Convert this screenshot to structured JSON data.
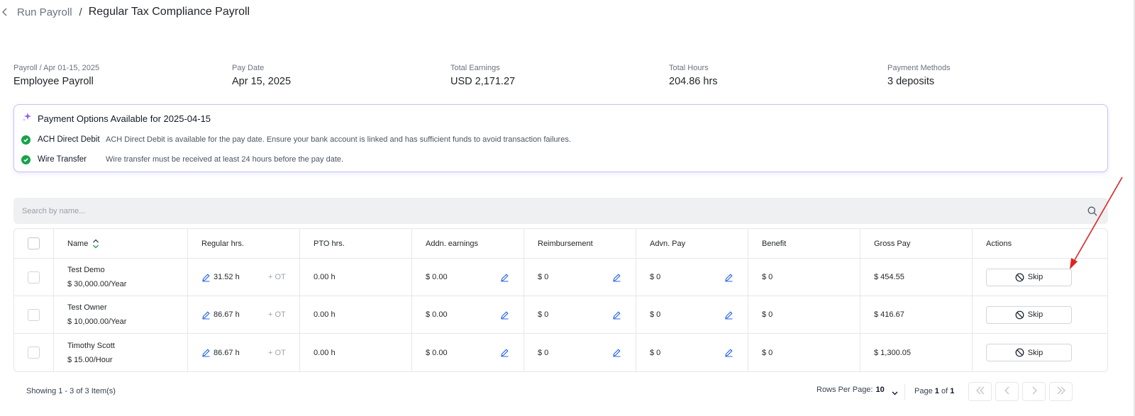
{
  "breadcrumb": {
    "parent": "Run Payroll",
    "separator": "/",
    "current": "Regular Tax Compliance Payroll"
  },
  "summary": [
    {
      "label": "Payroll / Apr 01-15, 2025",
      "value": "Employee Payroll"
    },
    {
      "label": "Pay Date",
      "value": "Apr 15, 2025"
    },
    {
      "label": "Total Earnings",
      "value": "USD 2,171.27"
    },
    {
      "label": "Total Hours",
      "value": "204.86 hrs"
    },
    {
      "label": "Payment Methods",
      "value": "3 deposits"
    }
  ],
  "payment_options": {
    "title": "Payment Options Available for 2025-04-15",
    "items": [
      {
        "name": "ACH Direct Debit",
        "description": "ACH Direct Debit is available for the pay date. Ensure your bank account is linked and has sufficient funds to avoid transaction failures."
      },
      {
        "name": "Wire Transfer",
        "description": "Wire transfer must be received at least 24 hours before the pay date."
      }
    ]
  },
  "search": {
    "placeholder": "Search by name..."
  },
  "table": {
    "columns": [
      "Name",
      "Regular hrs.",
      "PTO hrs.",
      "Addn. earnings",
      "Reimbursement",
      "Advn. Pay",
      "Benefit",
      "Gross Pay",
      "Actions"
    ],
    "ot_label": "+ OT",
    "skip_label": "Skip",
    "rows": [
      {
        "name": "Test Demo",
        "rate": "$ 30,000.00/Year",
        "regular": "31.52 h",
        "pto": "0.00 h",
        "addn": "$ 0.00",
        "reimb": "$ 0",
        "advn": "$ 0",
        "benefit": "$ 0",
        "gross": "$ 454.55"
      },
      {
        "name": "Test Owner",
        "rate": "$ 10,000.00/Year",
        "regular": "86.67 h",
        "pto": "0.00 h",
        "addn": "$ 0.00",
        "reimb": "$ 0",
        "advn": "$ 0",
        "benefit": "$ 0",
        "gross": "$ 416.67"
      },
      {
        "name": "Timothy Scott",
        "rate": "$ 15.00/Hour",
        "regular": "86.67 h",
        "pto": "0.00 h",
        "addn": "$ 0.00",
        "reimb": "$ 0",
        "advn": "$ 0",
        "benefit": "$ 0",
        "gross": "$ 1,300.05"
      }
    ]
  },
  "footer": {
    "showing": "Showing 1 - 3 of 3 Item(s)",
    "rows_per_page_label": "Rows Per Page:",
    "rows_per_page_value": "10",
    "page_prefix": "Page",
    "page_current": "1",
    "page_of": "of",
    "page_total": "1"
  },
  "icons": {
    "back": "chevron-left-icon",
    "sparkle": "sparkle-icon",
    "check": "check-circle-icon",
    "search": "search-icon",
    "sort": "sort-icon",
    "edit": "pencil-icon",
    "skip": "ban-icon",
    "first": "double-chevron-left-icon",
    "prev": "chevron-left-icon",
    "next": "chevron-right-icon",
    "last": "double-chevron-right-icon"
  },
  "colors": {
    "accent": "#8b5cf6",
    "success": "#16a34a",
    "edit": "#2563eb",
    "annotation": "#e02424"
  }
}
